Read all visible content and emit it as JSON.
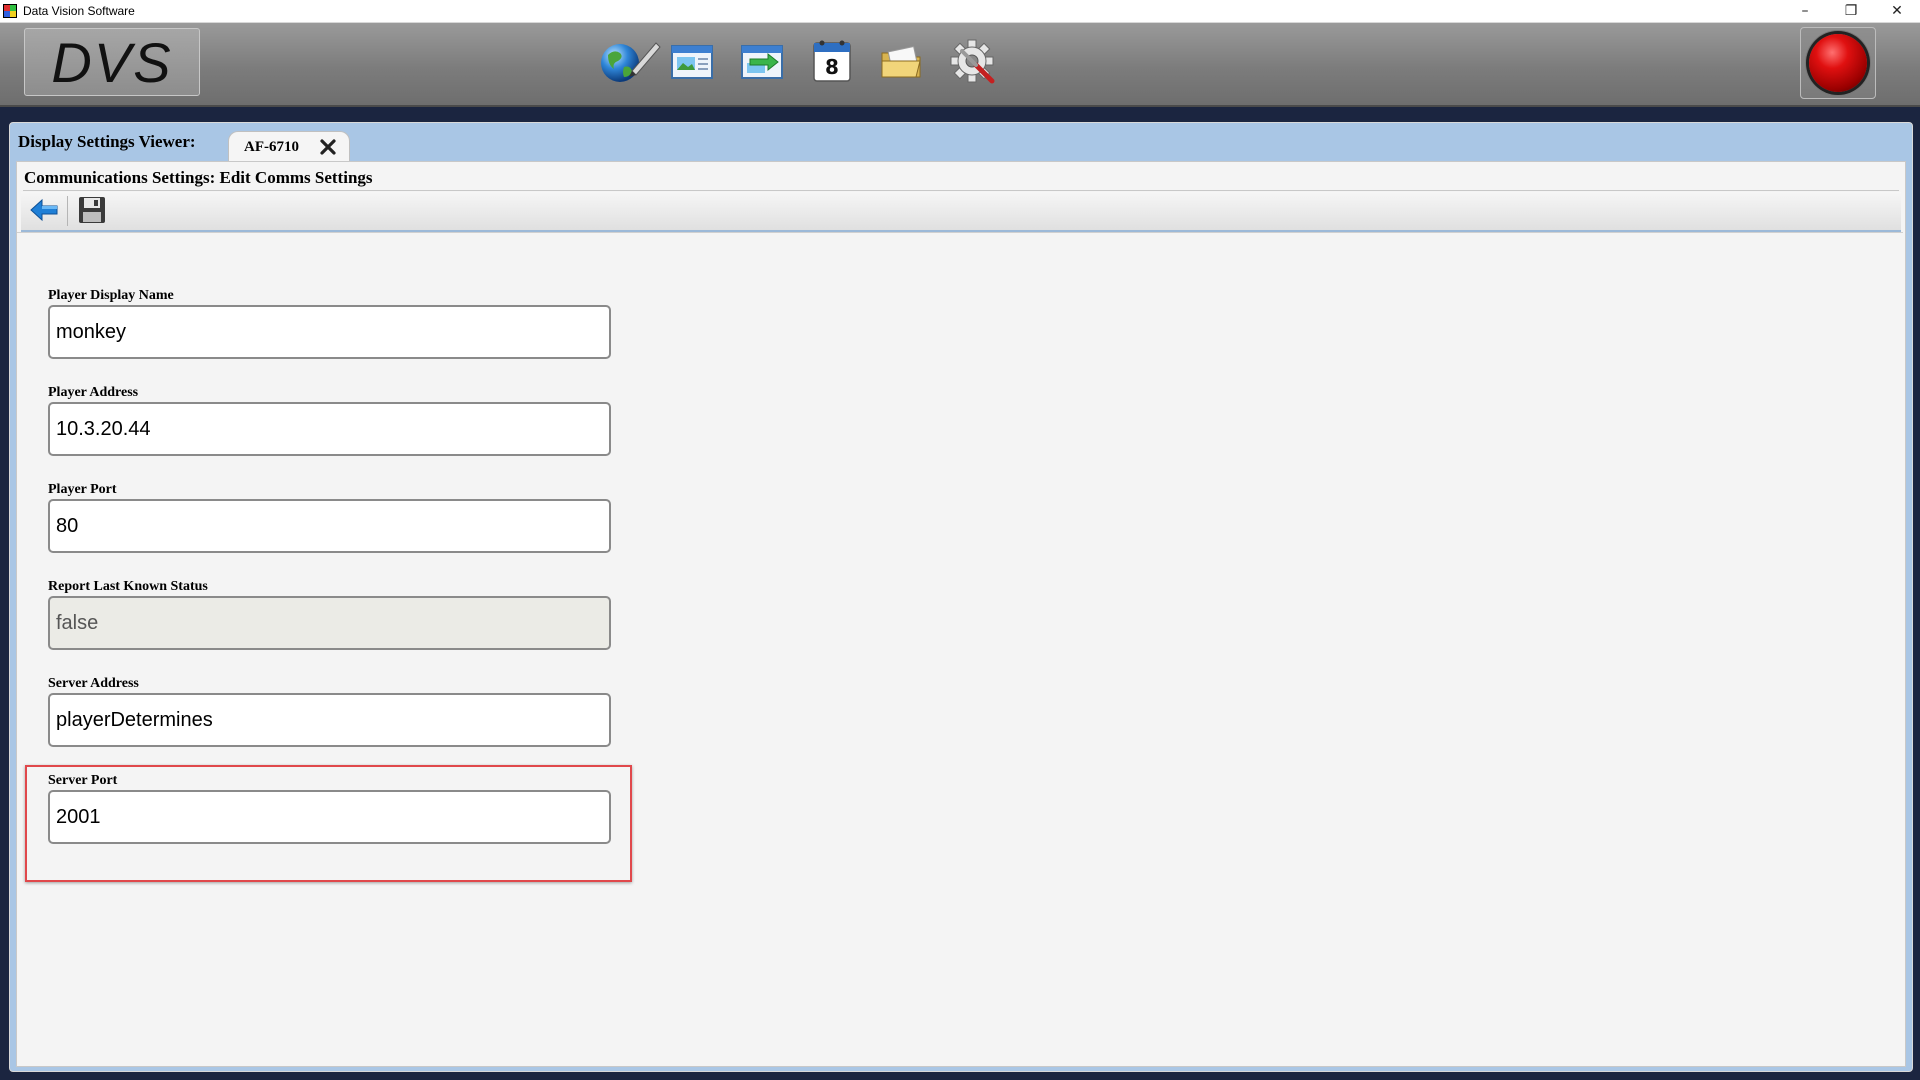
{
  "window": {
    "title": "Data Vision Software",
    "controls": {
      "minimize": "–",
      "restore": "❐",
      "close": "✕"
    }
  },
  "toolbar": {
    "logo": "DVS",
    "icons": [
      "globe-pencil-icon",
      "window-image-icon",
      "window-arrow-icon",
      "calendar-icon",
      "folder-icon",
      "gear-wrench-icon"
    ],
    "calendar_day": "8",
    "record_color": "#e01010"
  },
  "viewer": {
    "label": "Display Settings Viewer:",
    "tab_label": "AF-6710"
  },
  "page": {
    "breadcrumb": "Communications Settings: Edit Comms Settings"
  },
  "form": {
    "player_display_name": {
      "label": "Player Display Name",
      "value": "monkey"
    },
    "player_address": {
      "label": "Player Address",
      "value": "10.3.20.44"
    },
    "player_port": {
      "label": "Player Port",
      "value": "80"
    },
    "report_last_known_status": {
      "label": "Report Last Known Status",
      "value": "false"
    },
    "server_address": {
      "label": "Server Address",
      "value": "playerDetermines"
    },
    "server_port": {
      "label": "Server Port",
      "value": "2001"
    }
  },
  "colors": {
    "highlight": "#e0484b",
    "tabbar": "#a9c6e5",
    "accent_blue": "#1f7fd6"
  }
}
